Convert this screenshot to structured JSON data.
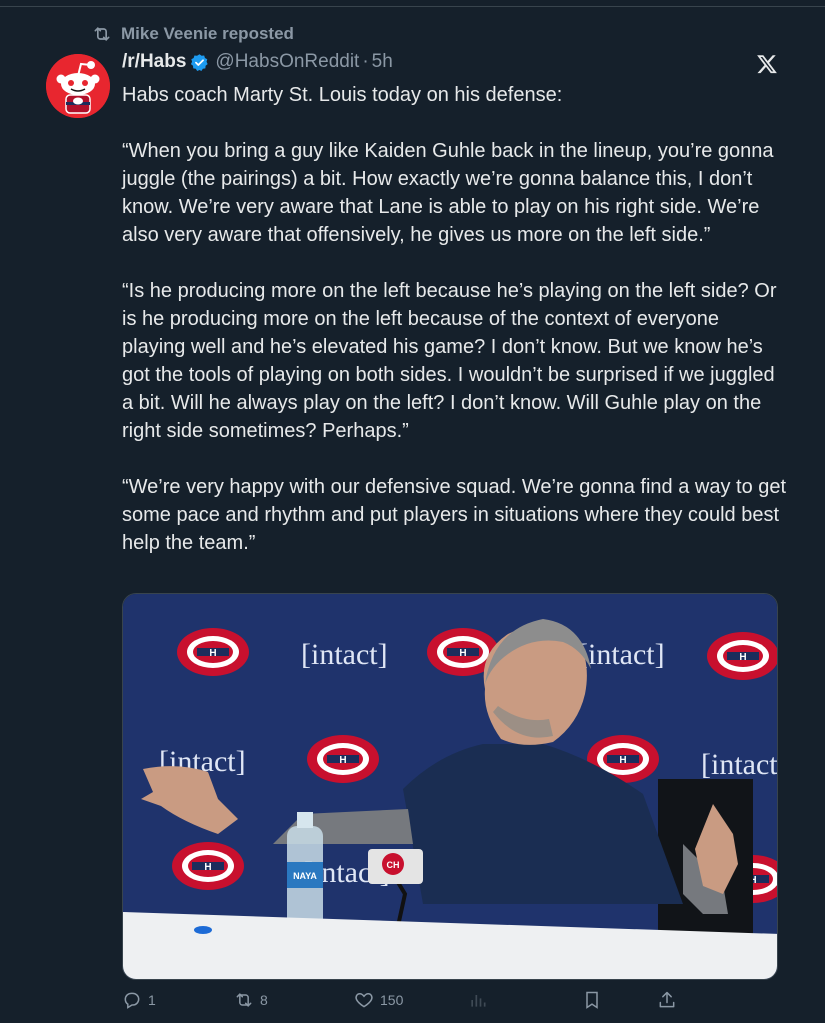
{
  "repost": {
    "icon": "repost-icon",
    "label": "Mike Veenie reposted"
  },
  "author": {
    "avatar": "reddit-snoo-avatar",
    "name": "/r/Habs",
    "verified_icon": "verified-badge-icon",
    "handle": "@HabsOnReddit",
    "separator": "·",
    "time": "5h"
  },
  "platform_icon": "x-logo-icon",
  "tweet": {
    "text": "Habs coach Marty St. Louis today on his defense:\n\n“When you bring a guy like Kaiden Guhle back in the lineup, you’re gonna juggle (the pairings) a bit. How exactly we’re gonna balance this, I don’t know. We’re very aware that Lane is able to play on his right side. We’re also very aware that offensively, he gives us more on the left side.”\n\n“Is he producing more on the left because he’s playing on the left side? Or is he producing more on the left because of the context of everyone playing well and he’s elevated his game? I don’t know. But we know he’s got the tools of playing on both sides. I wouldn’t be surprised if we juggled a bit. Will he always play on the left? I don’t know. Will Guhle play on the right side sometimes? Perhaps.”\n\n“We’re very happy with our defensive squad. We’re gonna find a way to get some pace and rhythm and put players in situations where they could best help the team.”"
  },
  "media": {
    "backdrop_word": "[intact]",
    "bottle_label": "NAYA",
    "mic_flag": "CH"
  },
  "actions": {
    "reply": {
      "icon": "reply-icon",
      "count": "1"
    },
    "repost": {
      "icon": "repost-icon",
      "count": "8"
    },
    "like": {
      "icon": "heart-icon",
      "count": "150"
    },
    "views": {
      "icon": "views-icon",
      "count": ""
    },
    "bookmark": {
      "icon": "bookmark-icon"
    },
    "share": {
      "icon": "share-icon"
    }
  },
  "colors": {
    "background": "#15202b",
    "text": "#e7e9ea",
    "muted": "#8b98a5",
    "verified": "#1d9bf0",
    "habs_red": "#c8102e",
    "habs_blue": "#1b2d5c"
  }
}
